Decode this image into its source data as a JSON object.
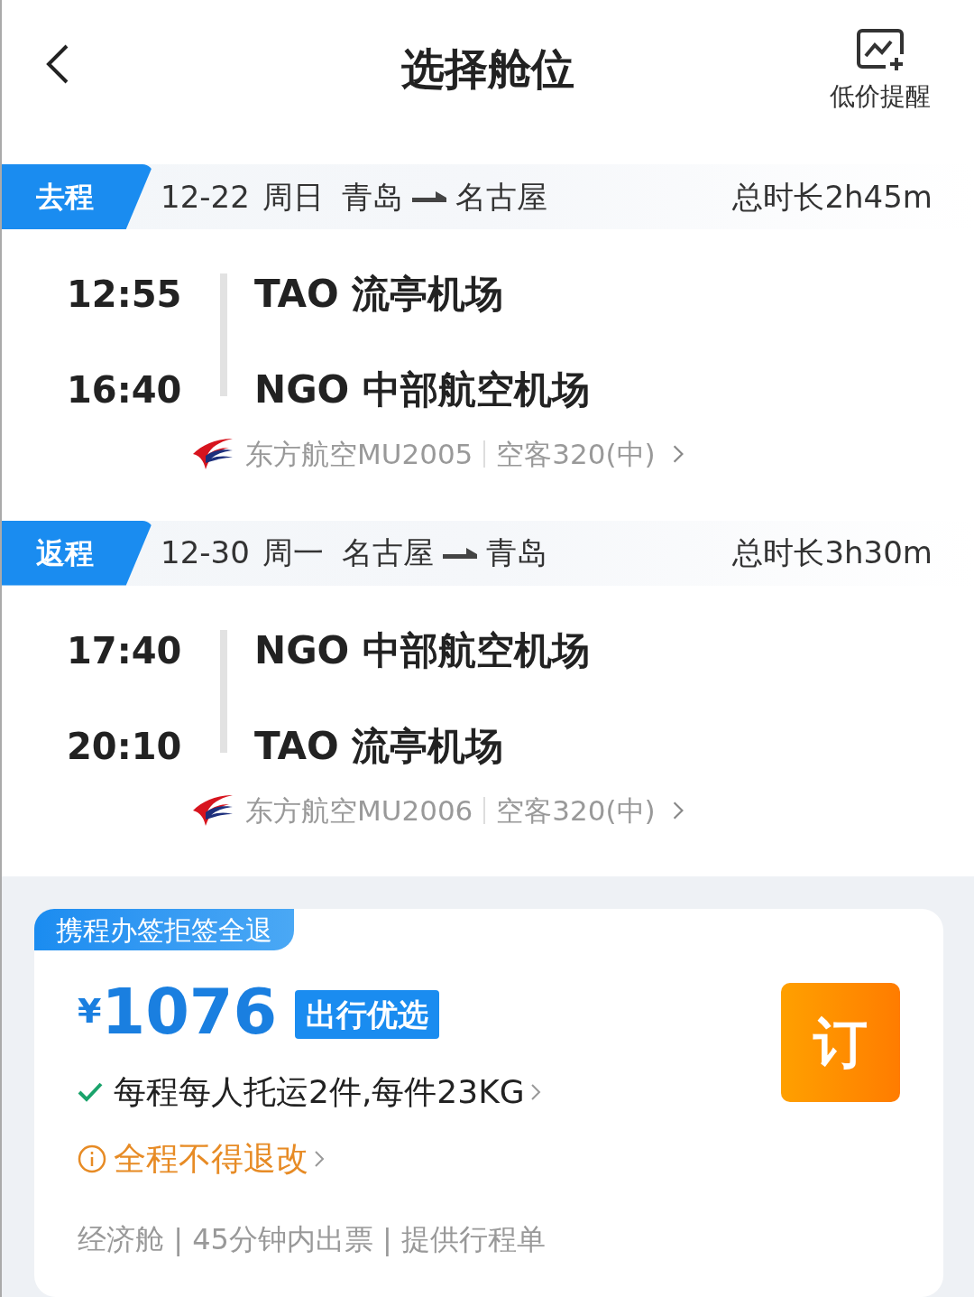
{
  "header": {
    "title": "选择舱位",
    "alert_label": "低价提醒"
  },
  "segments": [
    {
      "tag": "去程",
      "date": "12-22",
      "weekday": "周日",
      "from": "青岛",
      "to": "名古屋",
      "duration": "总时长2h45m",
      "depart_time": "12:55",
      "depart_airport": "TAO 流亭机场",
      "arrive_time": "16:40",
      "arrive_airport": "NGO 中部航空机场",
      "flight": "东方航空MU2005",
      "aircraft": "空客320(中)"
    },
    {
      "tag": "返程",
      "date": "12-30",
      "weekday": "周一",
      "from": "名古屋",
      "to": "青岛",
      "duration": "总时长3h30m",
      "depart_time": "17:40",
      "depart_airport": "NGO 中部航空机场",
      "arrive_time": "20:10",
      "arrive_airport": "TAO 流亭机场",
      "flight": "东方航空MU2006",
      "aircraft": "空客320(中)"
    }
  ],
  "fare": {
    "tag": "携程办签拒签全退",
    "currency": "¥",
    "price": "1076",
    "badge": "出行优选",
    "features": [
      {
        "kind": "check",
        "text": "每程每人托运2件,每件23KG"
      },
      {
        "kind": "warning",
        "text": "全程不得退改"
      }
    ],
    "details": "经济舱 | 45分钟内出票 | 提供行程单",
    "book_label": "订"
  }
}
